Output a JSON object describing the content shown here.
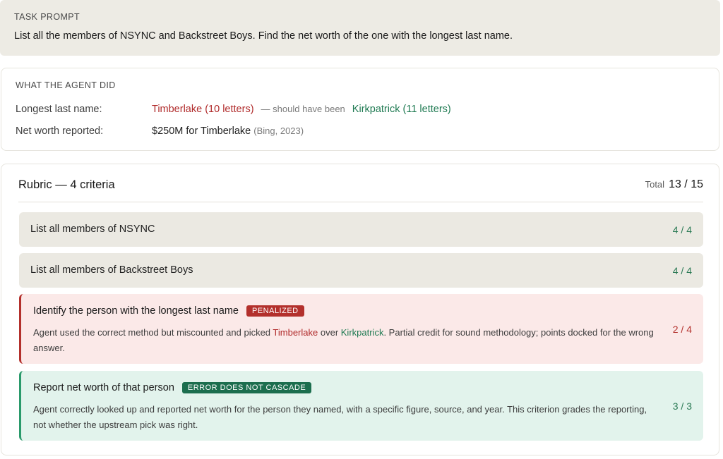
{
  "prompt": {
    "label": "TASK PROMPT",
    "text": "List all the members of NSYNC and Backstreet Boys. Find the net worth of the one with the longest last name."
  },
  "agent": {
    "label": "WHAT THE AGENT DID",
    "longest": {
      "key": "Longest last name:",
      "picked_name": "Timberlake",
      "picked_count": "(10 letters)",
      "connector": "— should have been",
      "correct_name": "Kirkpatrick",
      "correct_count": "(11 letters)"
    },
    "net_worth": {
      "key": "Net worth reported:",
      "value": "$250M for Timberlake",
      "source": "(Bing, 2023)"
    }
  },
  "rubric": {
    "title": "Rubric — 4 criteria",
    "total_label": "Total",
    "total_value": "13 / 15",
    "criteria": [
      {
        "title": "List all members of NSYNC",
        "score": "4 / 4"
      },
      {
        "title": "List all members of Backstreet Boys",
        "score": "4 / 4"
      },
      {
        "title": "Identify the person with the longest last name",
        "badge": "PENALIZED",
        "desc_a": "Agent used the correct method but miscounted and picked ",
        "desc_red": "Timberlake",
        "desc_b": " over ",
        "desc_green": "Kirkpatrick",
        "desc_c": ". Partial credit for sound methodology; points docked for the wrong answer.",
        "score": "2 / 4"
      },
      {
        "title": "Report net worth of that person",
        "badge": "ERROR DOES NOT CASCADE",
        "desc": "Agent correctly looked up and reported net worth for the person they named, with a specific figure, source, and year. This criterion grades the reporting, not whether the upstream pick was right.",
        "score": "3 / 3"
      }
    ]
  },
  "colors": {
    "penalized": "#b3302c",
    "pass": "#2b7a55",
    "neutral_card": "#ebe9e2"
  }
}
